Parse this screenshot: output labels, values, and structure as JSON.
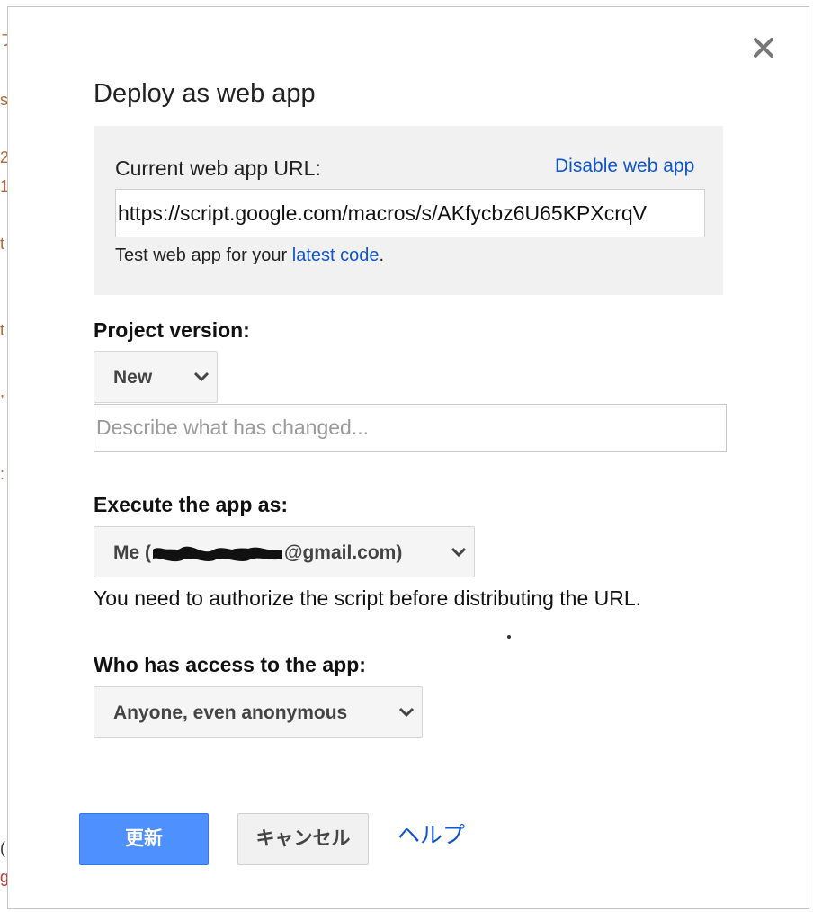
{
  "background_page": {
    "fragments": [
      "フ",
      "s",
      "2",
      "1",
      "t",
      "t",
      ",",
      ":",
      "(",
      "g"
    ]
  },
  "dialog": {
    "title": "Deploy as web app",
    "close_icon": "close-icon"
  },
  "url_panel": {
    "label": "Current web app URL:",
    "disable_link": "Disable web app",
    "url_value": "https://script.google.com/macros/s/AKfycbz6U65KPXcrqV",
    "test_prefix": "Test web app for your ",
    "test_link": "latest code",
    "test_suffix": "."
  },
  "project_version": {
    "label": "Project version:",
    "selected": "New",
    "description_placeholder": "Describe what has changed..."
  },
  "execute_as": {
    "label": "Execute the app as:",
    "selected_prefix": "Me (",
    "selected_suffix": "@gmail.com)",
    "note": "You need to authorize the script before distributing the URL."
  },
  "access": {
    "label": "Who has access to the app:",
    "selected": "Anyone, even anonymous"
  },
  "buttons": {
    "update": "更新",
    "cancel": "キャンセル",
    "help": "ヘルプ"
  },
  "colors": {
    "link": "#1155cc",
    "primary_button": "#4d90fe",
    "panel_background": "#f1f1f1"
  }
}
